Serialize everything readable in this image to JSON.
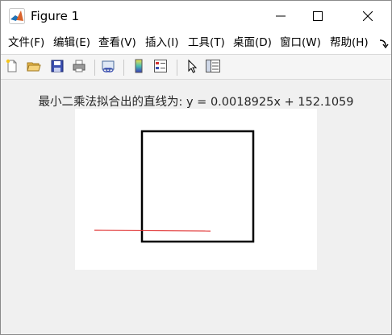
{
  "window": {
    "title": "Figure 1",
    "icon": "matlab-logo-icon",
    "controls": [
      "minimize-icon",
      "maximize-icon",
      "close-icon"
    ]
  },
  "menu": {
    "items": [
      "文件(F)",
      "编辑(E)",
      "查看(V)",
      "插入(I)",
      "工具(T)",
      "桌面(D)",
      "窗口(W)",
      "帮助(H)"
    ],
    "overflow_icon": "menu-overflow-arrow-icon"
  },
  "toolbar": {
    "icons": [
      "new-figure-icon",
      "open-folder-icon",
      "save-icon",
      "print-icon",
      "link-plot-icon",
      "colorbar-icon",
      "legend-icon",
      "pointer-icon",
      "property-editor-icon"
    ]
  },
  "plot": {
    "title": "最小二乘法拟合出的直线为: y = 0.0018925x + 152.1059",
    "background": "#ffffff",
    "figure_background": "#f0f0f0",
    "square_color": "#000000",
    "line_color": "#e03030"
  }
}
